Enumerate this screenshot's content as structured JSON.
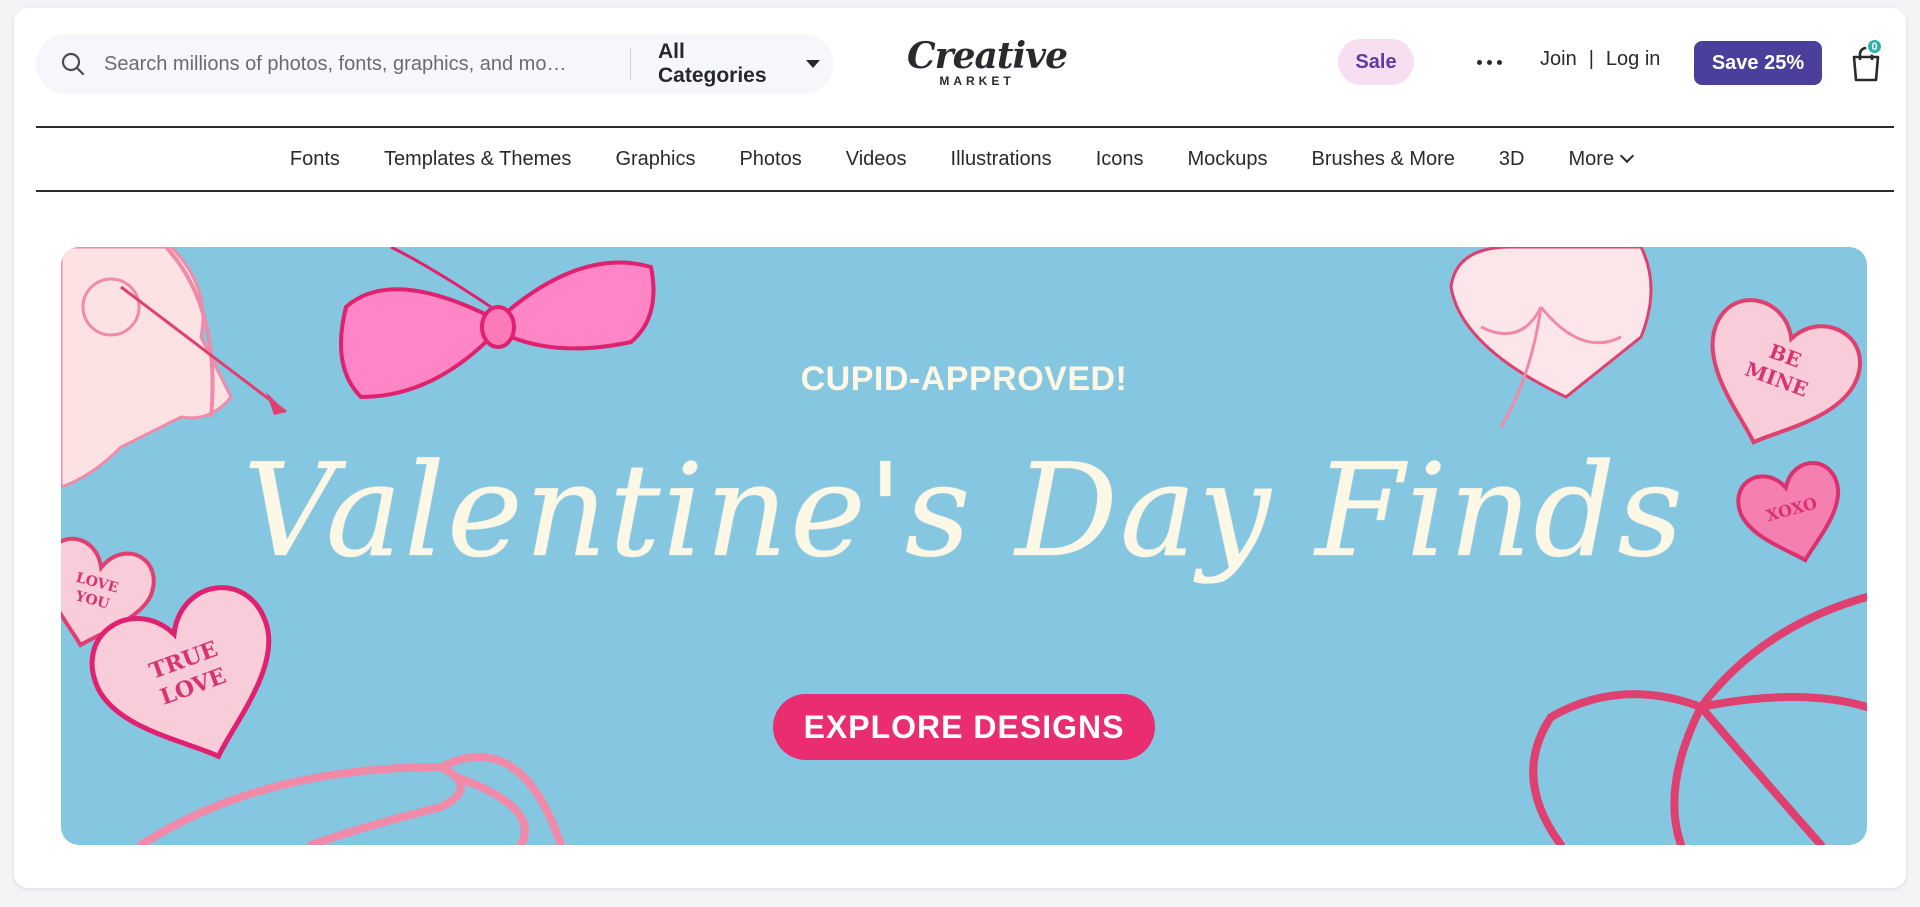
{
  "header": {
    "search": {
      "placeholder": "Search millions of photos, fonts, graphics, and mo…",
      "category": "All Categories"
    },
    "logo": {
      "main": "Creative",
      "sub": "MARKET"
    },
    "sale_label": "Sale",
    "join_label": "Join",
    "separator": "|",
    "login_label": "Log in",
    "save_label": "Save 25%",
    "cart_count": "0"
  },
  "nav": {
    "items": [
      "Fonts",
      "Templates & Themes",
      "Graphics",
      "Photos",
      "Videos",
      "Illustrations",
      "Icons",
      "Mockups",
      "Brushes & More",
      "3D"
    ],
    "more_label": "More"
  },
  "hero": {
    "kicker": "CUPID-APPROVED!",
    "title": "Valentine's Day Finds",
    "cta": "EXPLORE DESIGNS",
    "hearts": [
      "BE MINE",
      "XOXO",
      "LOVE YOU",
      "TRUE LOVE"
    ],
    "colors": {
      "background": "#85c6e1",
      "accent_pink": "#ea2c71",
      "cream": "#fdf7e6"
    }
  },
  "colors": {
    "brand_purple": "#4a3f9a",
    "sale_pink": "#f7def0",
    "badge_teal": "#2bb3a6"
  }
}
